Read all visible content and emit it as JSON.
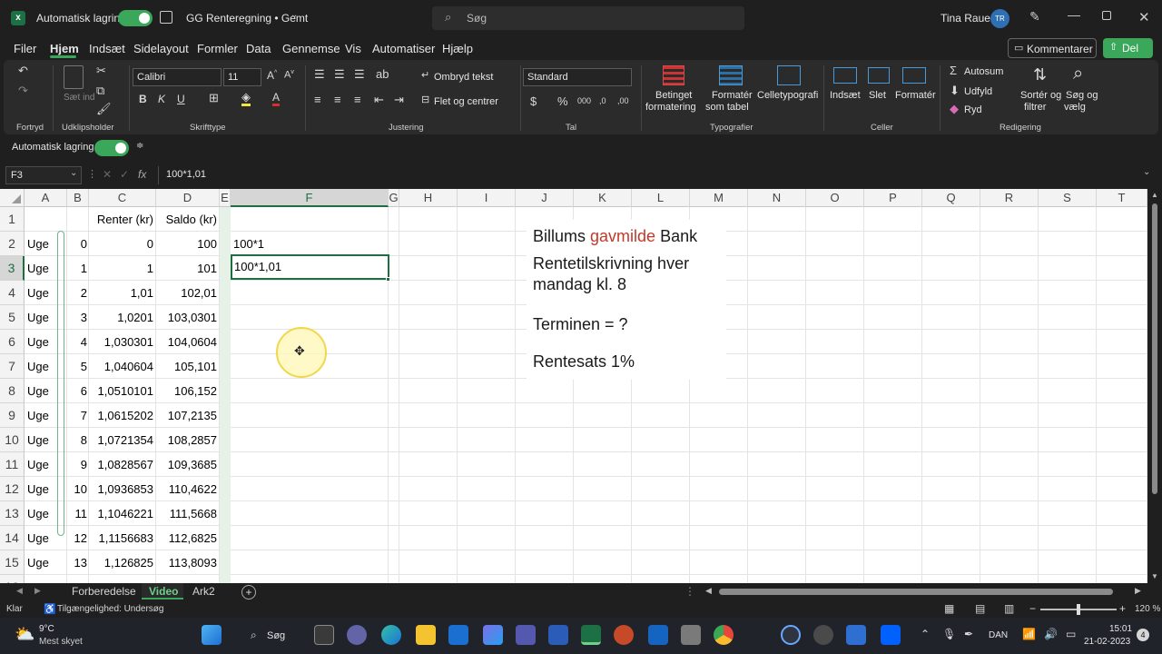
{
  "titlebar": {
    "app_icon": "excel-icon",
    "autosave_label": "Automatisk lagring",
    "file_title": "GG Renteregning • Gemt",
    "search_placeholder": "Søg",
    "user_name": "Tina Rauer",
    "user_initials": "TR"
  },
  "menu": {
    "items": [
      "Filer",
      "Hjem",
      "Indsæt",
      "Sidelayout",
      "Formler",
      "Data",
      "Gennemse",
      "Vis",
      "Automatiser",
      "Hjælp"
    ],
    "active": "Hjem",
    "comments_label": "Kommentarer",
    "share_label": "Del"
  },
  "ribbon": {
    "undo_group": "Fortryd",
    "clipboard_group": "Udklipsholder",
    "paste_label": "Sæt ind",
    "font_group": "Skrifttype",
    "font_name": "Calibri",
    "font_size": "11",
    "align_group": "Justering",
    "wrap_text": "Ombryd tekst",
    "merge_center": "Flet og centrer",
    "number_group": "Tal",
    "number_format": "Standard",
    "styles_group": "Typografier",
    "cond_format_1": "Betinget",
    "cond_format_2": "formatering",
    "format_table_1": "Formatér",
    "format_table_2": "som tabel",
    "cell_styles": "Celletypografi",
    "cells_group": "Celler",
    "insert": "Indsæt",
    "delete": "Slet",
    "format": "Formatér",
    "editing_group": "Redigering",
    "autosum": "Autosum",
    "fill": "Udfyld",
    "clear": "Ryd",
    "sort_1": "Sortér og",
    "sort_2": "filtrer",
    "find_1": "Søg og",
    "find_2": "vælg"
  },
  "qab": {
    "autosave_label": "Automatisk lagring"
  },
  "formula_bar": {
    "name_box": "F3",
    "fx": "fx",
    "content": "100*1,01"
  },
  "grid": {
    "columns": [
      "A",
      "B",
      "C",
      "D",
      "E",
      "F",
      "G",
      "H",
      "I",
      "J",
      "K",
      "L",
      "M",
      "N",
      "O",
      "P",
      "Q",
      "R",
      "S",
      "T"
    ],
    "rows": [
      "1",
      "2",
      "3",
      "4",
      "5",
      "6",
      "7",
      "8",
      "9",
      "10",
      "11",
      "12",
      "13",
      "14",
      "15",
      "16"
    ],
    "header_c": "Renter (kr)",
    "header_d": "Saldo (kr)",
    "data": [
      {
        "a": "Uge",
        "b": "0",
        "c": "0",
        "d": "100"
      },
      {
        "a": "Uge",
        "b": "1",
        "c": "1",
        "d": "101"
      },
      {
        "a": "Uge",
        "b": "2",
        "c": "1,01",
        "d": "102,01"
      },
      {
        "a": "Uge",
        "b": "3",
        "c": "1,0201",
        "d": "103,0301"
      },
      {
        "a": "Uge",
        "b": "4",
        "c": "1,030301",
        "d": "104,0604"
      },
      {
        "a": "Uge",
        "b": "5",
        "c": "1,040604",
        "d": "105,101"
      },
      {
        "a": "Uge",
        "b": "6",
        "c": "1,0510101",
        "d": "106,152"
      },
      {
        "a": "Uge",
        "b": "7",
        "c": "1,0615202",
        "d": "107,2135"
      },
      {
        "a": "Uge",
        "b": "8",
        "c": "1,0721354",
        "d": "108,2857"
      },
      {
        "a": "Uge",
        "b": "9",
        "c": "1,0828567",
        "d": "109,3685"
      },
      {
        "a": "Uge",
        "b": "10",
        "c": "1,0936853",
        "d": "110,4622"
      },
      {
        "a": "Uge",
        "b": "11",
        "c": "1,1046221",
        "d": "111,5668"
      },
      {
        "a": "Uge",
        "b": "12",
        "c": "1,1156683",
        "d": "112,6825"
      },
      {
        "a": "Uge",
        "b": "13",
        "c": "1,126825",
        "d": "113,8093"
      }
    ],
    "f2": "100*1",
    "f3": "100*1,01",
    "textbox": {
      "line1_a": "Billums",
      "line1_b": "gavmilde",
      "line1_c": "Bank",
      "line2": "Rentetilskrivning hver",
      "line3": "mandag kl. 8",
      "line4": "Terminen = ?",
      "line5": "Rentesats 1%"
    },
    "accent_red": "#c0392b"
  },
  "sheets": {
    "tabs": [
      "Forberedelse",
      "Video",
      "Ark2"
    ],
    "active": "Video"
  },
  "status": {
    "ready": "Klar",
    "accessibility": "Tilgængelighed: Undersøg",
    "zoom": "120 %"
  },
  "taskbar": {
    "temp": "9°C",
    "weather": "Mest skyet",
    "search": "Søg",
    "lang": "DAN",
    "time": "15:01",
    "date": "21-02-2023",
    "badge": "4"
  }
}
